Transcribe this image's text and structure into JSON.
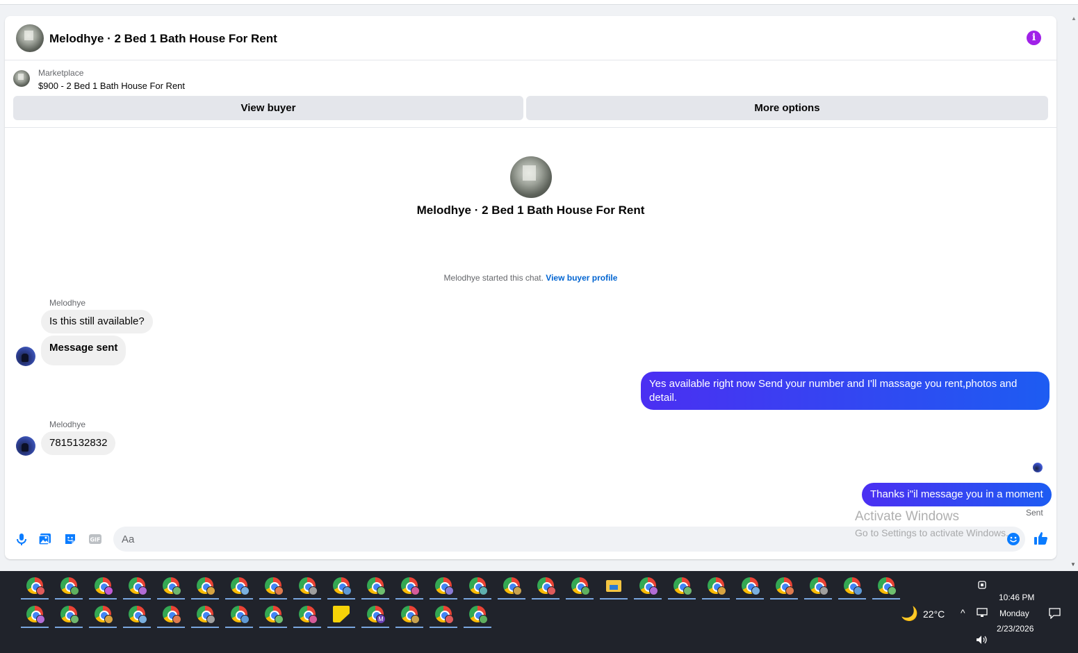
{
  "header": {
    "title": "Melodhye · 2 Bed 1 Bath House For Rent",
    "info_icon": "info-icon",
    "info_color": "#a021e8"
  },
  "marketplace": {
    "label": "Marketplace",
    "listing": "$900 - 2 Bed 1 Bath House For Rent",
    "view_buyer_label": "View buyer",
    "more_options_label": "More options"
  },
  "intro": {
    "title": "Melodhye · 2 Bed 1 Bath House For Rent",
    "started_text": "Melodhye started this chat.",
    "view_profile_link": "View buyer profile"
  },
  "messages": {
    "sender_1": "Melodhye",
    "in_1": "Is this still available?",
    "in_2": "Message sent",
    "out_1": "Yes available right now Send your number and I'll massage you rent,photos and detail.",
    "sender_2": "Melodhye",
    "in_3": "7815132832",
    "out_2": "Thanks i\"il message you in a moment",
    "sent_status": "Sent",
    "accent_color": "#0a7cff"
  },
  "watermark": {
    "line1": "Activate Windows",
    "line2": "Go to Settings to activate Windows."
  },
  "composer": {
    "placeholder": "Aa",
    "value": "",
    "icons": [
      "microphone-icon",
      "photo-icon",
      "sticker-icon",
      "gif-icon",
      "emoji-icon",
      "thumbs-up-icon"
    ]
  },
  "taskbar": {
    "weather": "22°C",
    "weather_icon": "moon-icon",
    "time": "10:46 PM",
    "day": "Monday",
    "date": "2/23/2026"
  }
}
